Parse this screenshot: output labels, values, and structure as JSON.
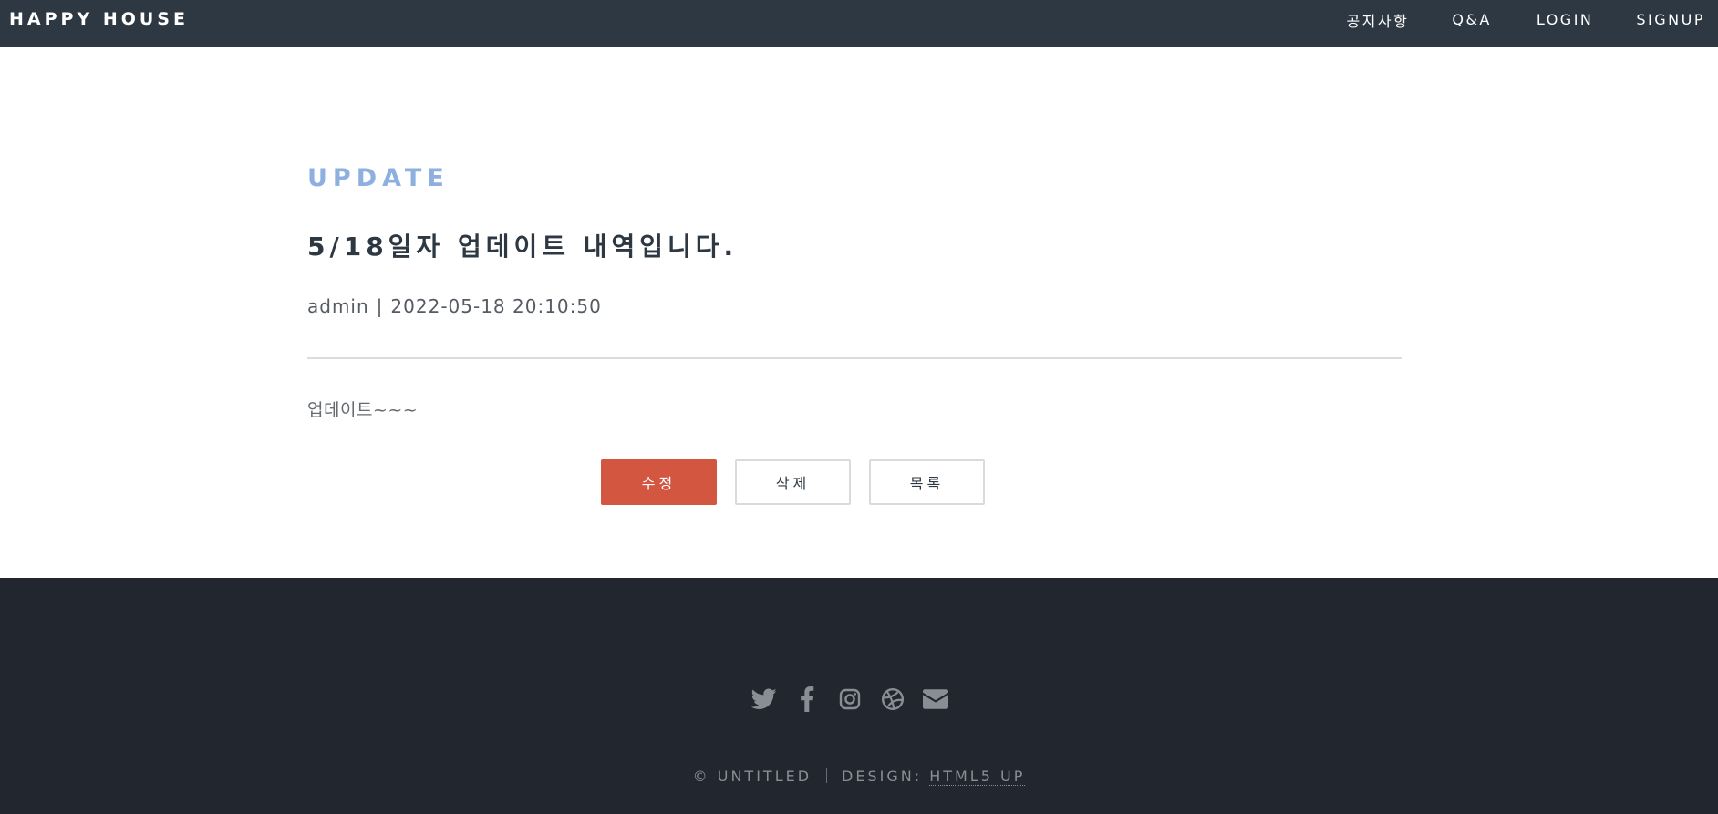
{
  "header": {
    "logo": "HAPPY HOUSE",
    "nav": [
      {
        "label": "공지사항"
      },
      {
        "label": "Q&A"
      },
      {
        "label": "LOGIN"
      },
      {
        "label": "SIGNUP"
      }
    ]
  },
  "post": {
    "category": "UPDATE",
    "title": "5/18일자 업데이트 내역입니다.",
    "author": "admin",
    "separator": "|",
    "date": "2022-05-18 20:10:50",
    "content": "업데이트~~~"
  },
  "buttons": {
    "edit": "수정",
    "delete": "삭제",
    "list": "목록"
  },
  "footer": {
    "icons": [
      "twitter-icon",
      "facebook-icon",
      "instagram-icon",
      "dribbble-icon",
      "envelope-icon"
    ],
    "copyright": "© UNTITLED",
    "design_label": "DESIGN:",
    "design_link": "HTML5 UP"
  },
  "colors": {
    "header_bg": "#2e3842",
    "footer_bg": "#22262e",
    "accent": "#d25640",
    "category": "#8eb0e0"
  }
}
